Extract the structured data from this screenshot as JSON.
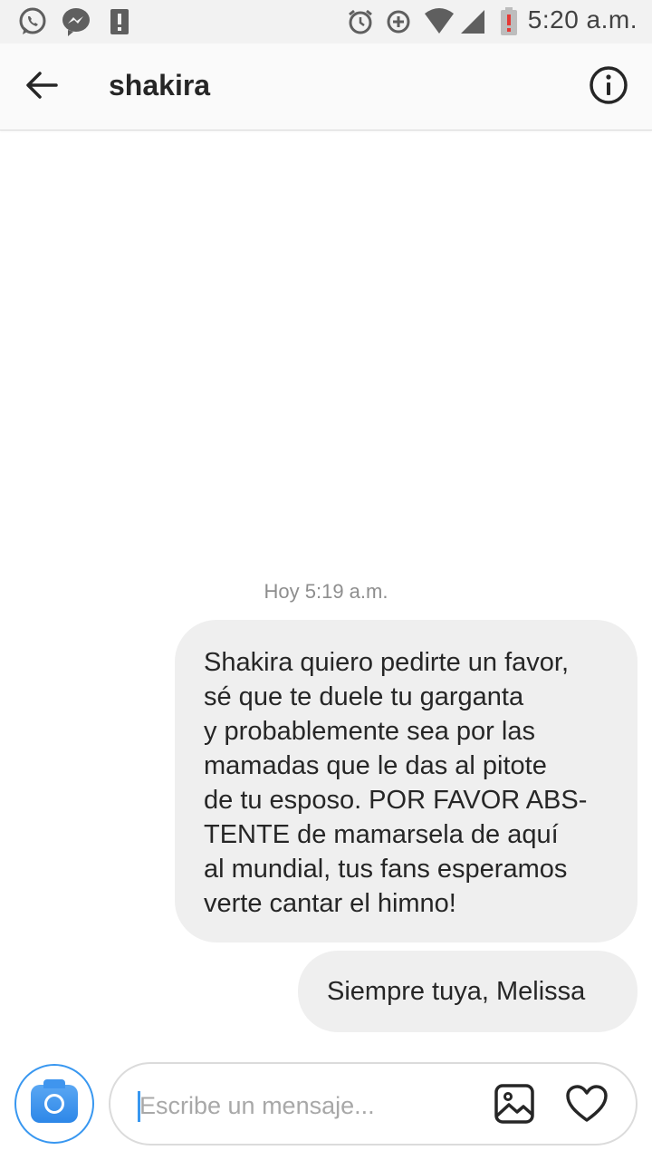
{
  "status_bar": {
    "time": "5:20 a.m.",
    "left_icons": [
      "whatsapp-icon",
      "messenger-icon",
      "alert-icon"
    ],
    "right_icons": [
      "alarm-icon",
      "data-saver-icon",
      "wifi-icon",
      "signal-icon",
      "battery-low-icon"
    ],
    "battery_alert_color": "#e53935"
  },
  "header": {
    "title": "shakira",
    "back_icon": "arrow-left-icon",
    "info_icon": "info-icon"
  },
  "thread": {
    "timestamp": "Hoy 5:19 a.m.",
    "messages": [
      {
        "lines": [
          "Shakira quiero pedirte un favor,",
          "sé que te duele tu garganta",
          "y probablemente sea por las",
          "mamadas que le das al pitote",
          "de tu esposo. POR FAVOR ABS-",
          "TENTE de mamarsela de aquí",
          "al mundial, tus fans esperamos",
          "verte cantar el himno!"
        ]
      },
      {
        "text": "Siempre tuya, Melissa"
      }
    ]
  },
  "composer": {
    "placeholder": "Escribe un mensaje...",
    "camera_icon": "camera-icon",
    "gallery_icon": "gallery-icon",
    "like_icon": "heart-icon",
    "accent": "#3897f0"
  },
  "colors": {
    "bubble_bg": "#efefef",
    "status_bar_bg": "#f2f2f2",
    "header_bg": "#fafafa"
  }
}
